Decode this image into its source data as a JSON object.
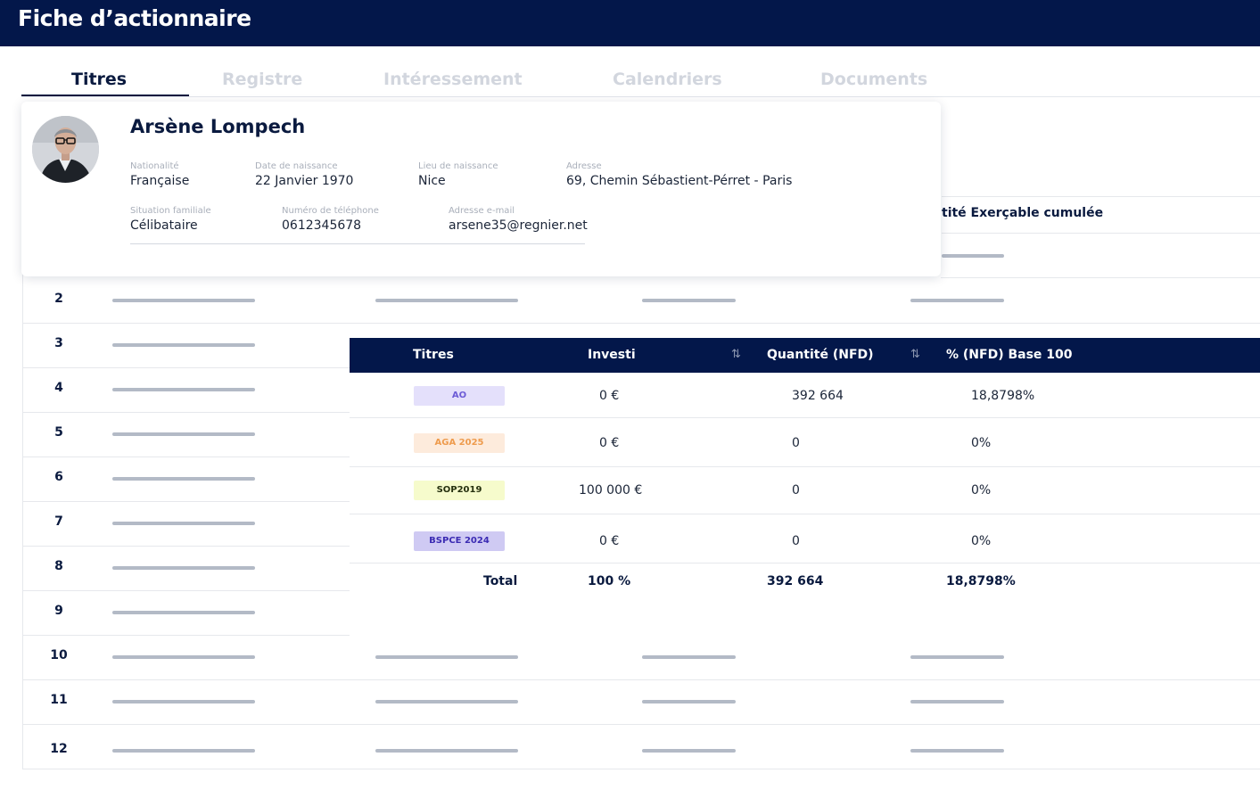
{
  "header": {
    "title": "Fiche d’actionnaire"
  },
  "tabs": [
    {
      "label": "Titres",
      "active": true
    },
    {
      "label": "Registre",
      "active": false
    },
    {
      "label": "Intéressement",
      "active": false
    },
    {
      "label": "Calendriers",
      "active": false
    },
    {
      "label": "Documents",
      "active": false
    }
  ],
  "background_table": {
    "visible_header": "tité Exerçable cumulée",
    "row_numbers": [
      "2",
      "3",
      "4",
      "5",
      "6",
      "7",
      "8",
      "9",
      "10",
      "11",
      "12"
    ]
  },
  "profile": {
    "name": "Arsène Lompech",
    "avatar": "profile-photo",
    "fields": {
      "nationality": {
        "label": "Nationalité",
        "value": "Française"
      },
      "birth_date": {
        "label": "Date de naissance",
        "value": "22 Janvier 1970"
      },
      "birth_place": {
        "label": "Lieu de naissance",
        "value": "Nice"
      },
      "address": {
        "label": "Adresse",
        "value": "69, Chemin Sébastient-Pérret - Paris"
      },
      "family_status": {
        "label": "Situation familiale",
        "value": "Célibataire"
      },
      "phone": {
        "label": "Numéro de téléphone",
        "value": "0612345678"
      },
      "email": {
        "label": "Adresse e-mail",
        "value": "arsene35@regnier.net"
      }
    }
  },
  "titres_table": {
    "columns": {
      "titres": "Titres",
      "investi": "Investi",
      "quantite": "Quantité (NFD)",
      "base": "% (NFD) Base 100"
    },
    "sort_icon": "sort-updown-icon",
    "rows": [
      {
        "badge": "AO",
        "badge_bg": "#e4e0fb",
        "badge_fg": "#6c5bd6",
        "investi": "0 €",
        "quantite": "392 664",
        "base": "18,8798%"
      },
      {
        "badge": "AGA 2025",
        "badge_bg": "#fdebdc",
        "badge_fg": "#ee9b4d",
        "investi": "0 €",
        "quantite": "0",
        "base": "0%"
      },
      {
        "badge": "SOP2019",
        "badge_bg": "#f6fbcc",
        "badge_fg": "#26310f",
        "investi": "100 000 €",
        "quantite": "0",
        "base": "0%"
      },
      {
        "badge": "BSPCE 2024",
        "badge_bg": "#cfcaf3",
        "badge_fg": "#3b2bb3",
        "investi": "0 €",
        "quantite": "0",
        "base": "0%"
      }
    ],
    "total": {
      "label": "Total",
      "investi": "100 %",
      "quantite": "392 664",
      "base": "18,8798%"
    }
  },
  "colors": {
    "primary": "#03174a",
    "placeholder": "#b3bac6"
  }
}
